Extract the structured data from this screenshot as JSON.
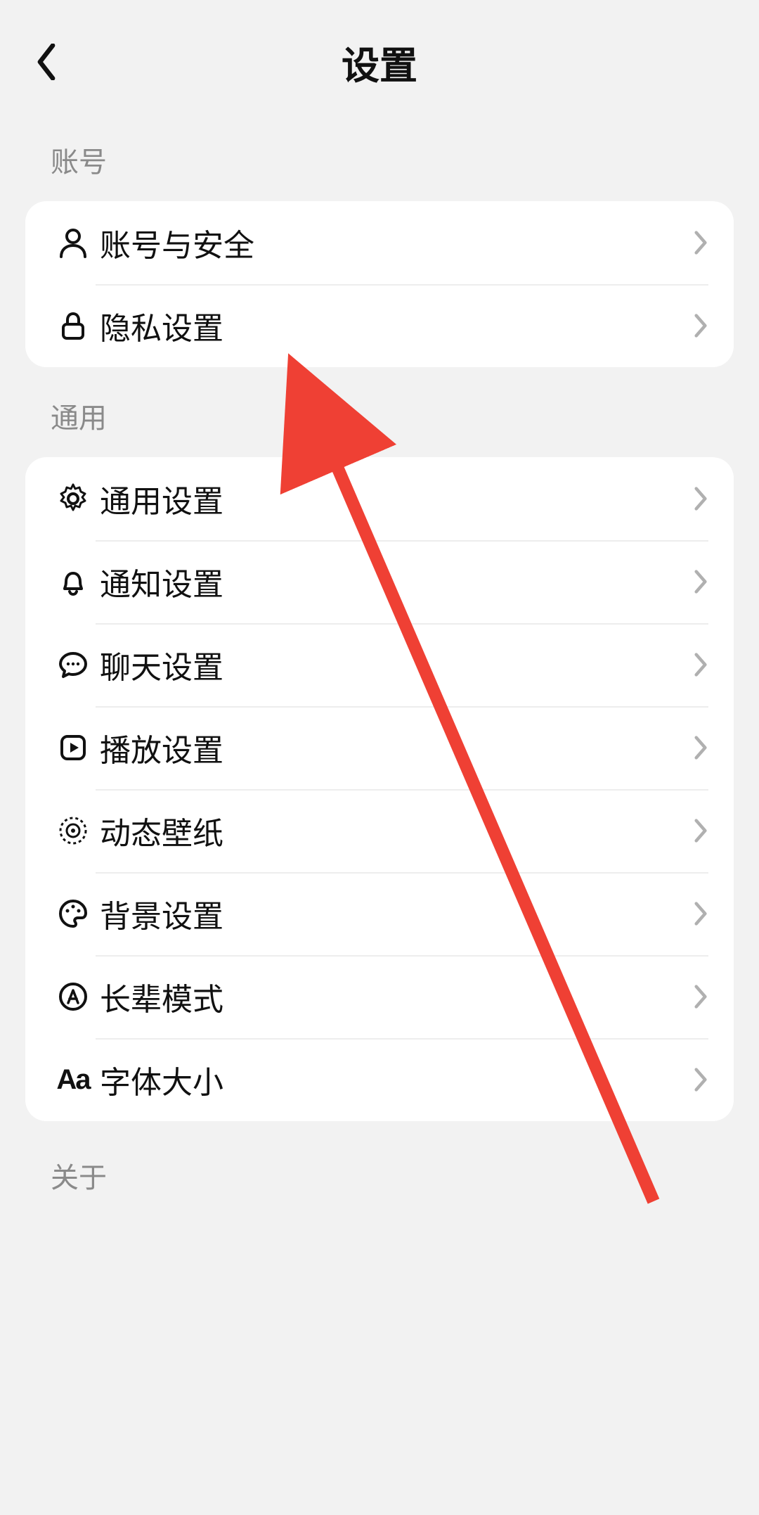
{
  "header": {
    "title": "设置"
  },
  "sections": {
    "account": {
      "label": "账号",
      "items": [
        {
          "icon": "person-icon",
          "label": "账号与安全"
        },
        {
          "icon": "lock-icon",
          "label": "隐私设置"
        }
      ]
    },
    "general": {
      "label": "通用",
      "items": [
        {
          "icon": "gear-icon",
          "label": "通用设置"
        },
        {
          "icon": "bell-icon",
          "label": "通知设置"
        },
        {
          "icon": "chat-icon",
          "label": "聊天设置"
        },
        {
          "icon": "play-icon",
          "label": "播放设置"
        },
        {
          "icon": "wallpaper-icon",
          "label": "动态壁纸"
        },
        {
          "icon": "palette-icon",
          "label": "背景设置"
        },
        {
          "icon": "a-circle-icon",
          "label": "长辈模式"
        },
        {
          "icon": "aa-icon",
          "label": "字体大小"
        }
      ]
    },
    "about": {
      "label": "关于"
    }
  }
}
